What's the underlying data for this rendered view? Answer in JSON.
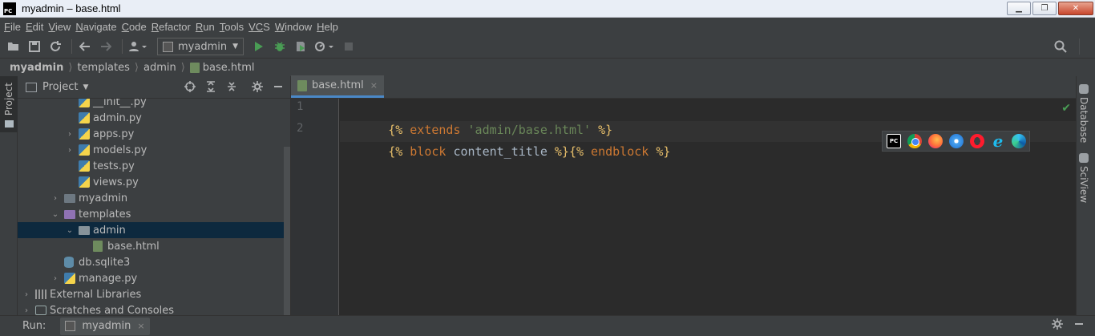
{
  "window": {
    "title": "myadmin – base.html",
    "logo_text": "PC",
    "controls": {
      "minimize": "▁",
      "maximize": "❐",
      "close": "✕"
    }
  },
  "menu": {
    "items": [
      {
        "first": "F",
        "rest": "ile"
      },
      {
        "first": "E",
        "rest": "dit"
      },
      {
        "first": "V",
        "rest": "iew"
      },
      {
        "first": "N",
        "rest": "avigate"
      },
      {
        "first": "C",
        "rest": "ode"
      },
      {
        "first": "R",
        "rest": "efactor"
      },
      {
        "first": "R",
        "rest": "un"
      },
      {
        "first": "T",
        "rest": "ools"
      },
      {
        "first": "VC",
        "rest": "S"
      },
      {
        "first": "W",
        "rest": "indow"
      },
      {
        "first": "H",
        "rest": "elp"
      }
    ]
  },
  "toolbar": {
    "run_config": "myadmin",
    "icons": {
      "open": "folder-open-icon",
      "save": "save-icon",
      "sync": "sync-icon",
      "back": "arrow-left-icon",
      "forward": "arrow-right-icon",
      "run": "run-icon",
      "debug": "debug-icon",
      "search": "search-icon"
    }
  },
  "breadcrumb": {
    "root": "myadmin",
    "parts": [
      "templates",
      "admin",
      "base.html"
    ],
    "separator": "⟩"
  },
  "left_strip": {
    "label": "Project"
  },
  "project_panel": {
    "title": "Project",
    "tree": [
      {
        "label": "__init__.py",
        "indent": 4,
        "arrow": "",
        "icon": "py"
      },
      {
        "label": "admin.py",
        "indent": 4,
        "arrow": "",
        "icon": "py"
      },
      {
        "label": "apps.py",
        "indent": 4,
        "arrow": "›",
        "icon": "py"
      },
      {
        "label": "models.py",
        "indent": 4,
        "arrow": "›",
        "icon": "py"
      },
      {
        "label": "tests.py",
        "indent": 4,
        "arrow": "",
        "icon": "py"
      },
      {
        "label": "views.py",
        "indent": 4,
        "arrow": "",
        "icon": "py"
      },
      {
        "label": "myadmin",
        "indent": 3,
        "arrow": "›",
        "icon": "folder-dark"
      },
      {
        "label": "templates",
        "indent": 3,
        "arrow": "⌄",
        "icon": "folder-purple"
      },
      {
        "label": "admin",
        "indent": 4,
        "arrow": "⌄",
        "icon": "folder"
      },
      {
        "label": "base.html",
        "indent": 5,
        "arrow": "",
        "icon": "html"
      },
      {
        "label": "db.sqlite3",
        "indent": 3,
        "arrow": "",
        "icon": "db"
      },
      {
        "label": "manage.py",
        "indent": 3,
        "arrow": "›",
        "icon": "py"
      },
      {
        "label": "External Libraries",
        "indent": 1,
        "arrow": "›",
        "icon": "lib"
      },
      {
        "label": "Scratches and Consoles",
        "indent": 1,
        "arrow": "›",
        "icon": "scratch"
      }
    ],
    "selected_label": "admin"
  },
  "editor": {
    "tab_label": "base.html",
    "tab_close": "×",
    "lines": [
      {
        "number": "1",
        "d1": "{%",
        "kw": " extends ",
        "str": "'admin/base.html'",
        "plain": "",
        "kw2": "",
        "d2": " %}"
      },
      {
        "number": "2",
        "d1": "{%",
        "kw": " block ",
        "str": "",
        "plain": "content_title ",
        "kw2": "",
        "d2": "%}"
      }
    ],
    "line2_tail": {
      "d3": "{%",
      "kw": " endblock ",
      "d4": "%}"
    },
    "check": "✔"
  },
  "browsers": [
    "pycharm-icon",
    "chrome-icon",
    "firefox-icon",
    "safari-icon",
    "opera-icon",
    "ie-icon",
    "edge-icon"
  ],
  "right_strip": {
    "tabs": [
      "Database",
      "SciView"
    ]
  },
  "runbar": {
    "label": "Run:",
    "tab": "myadmin",
    "tab_close": "×"
  }
}
